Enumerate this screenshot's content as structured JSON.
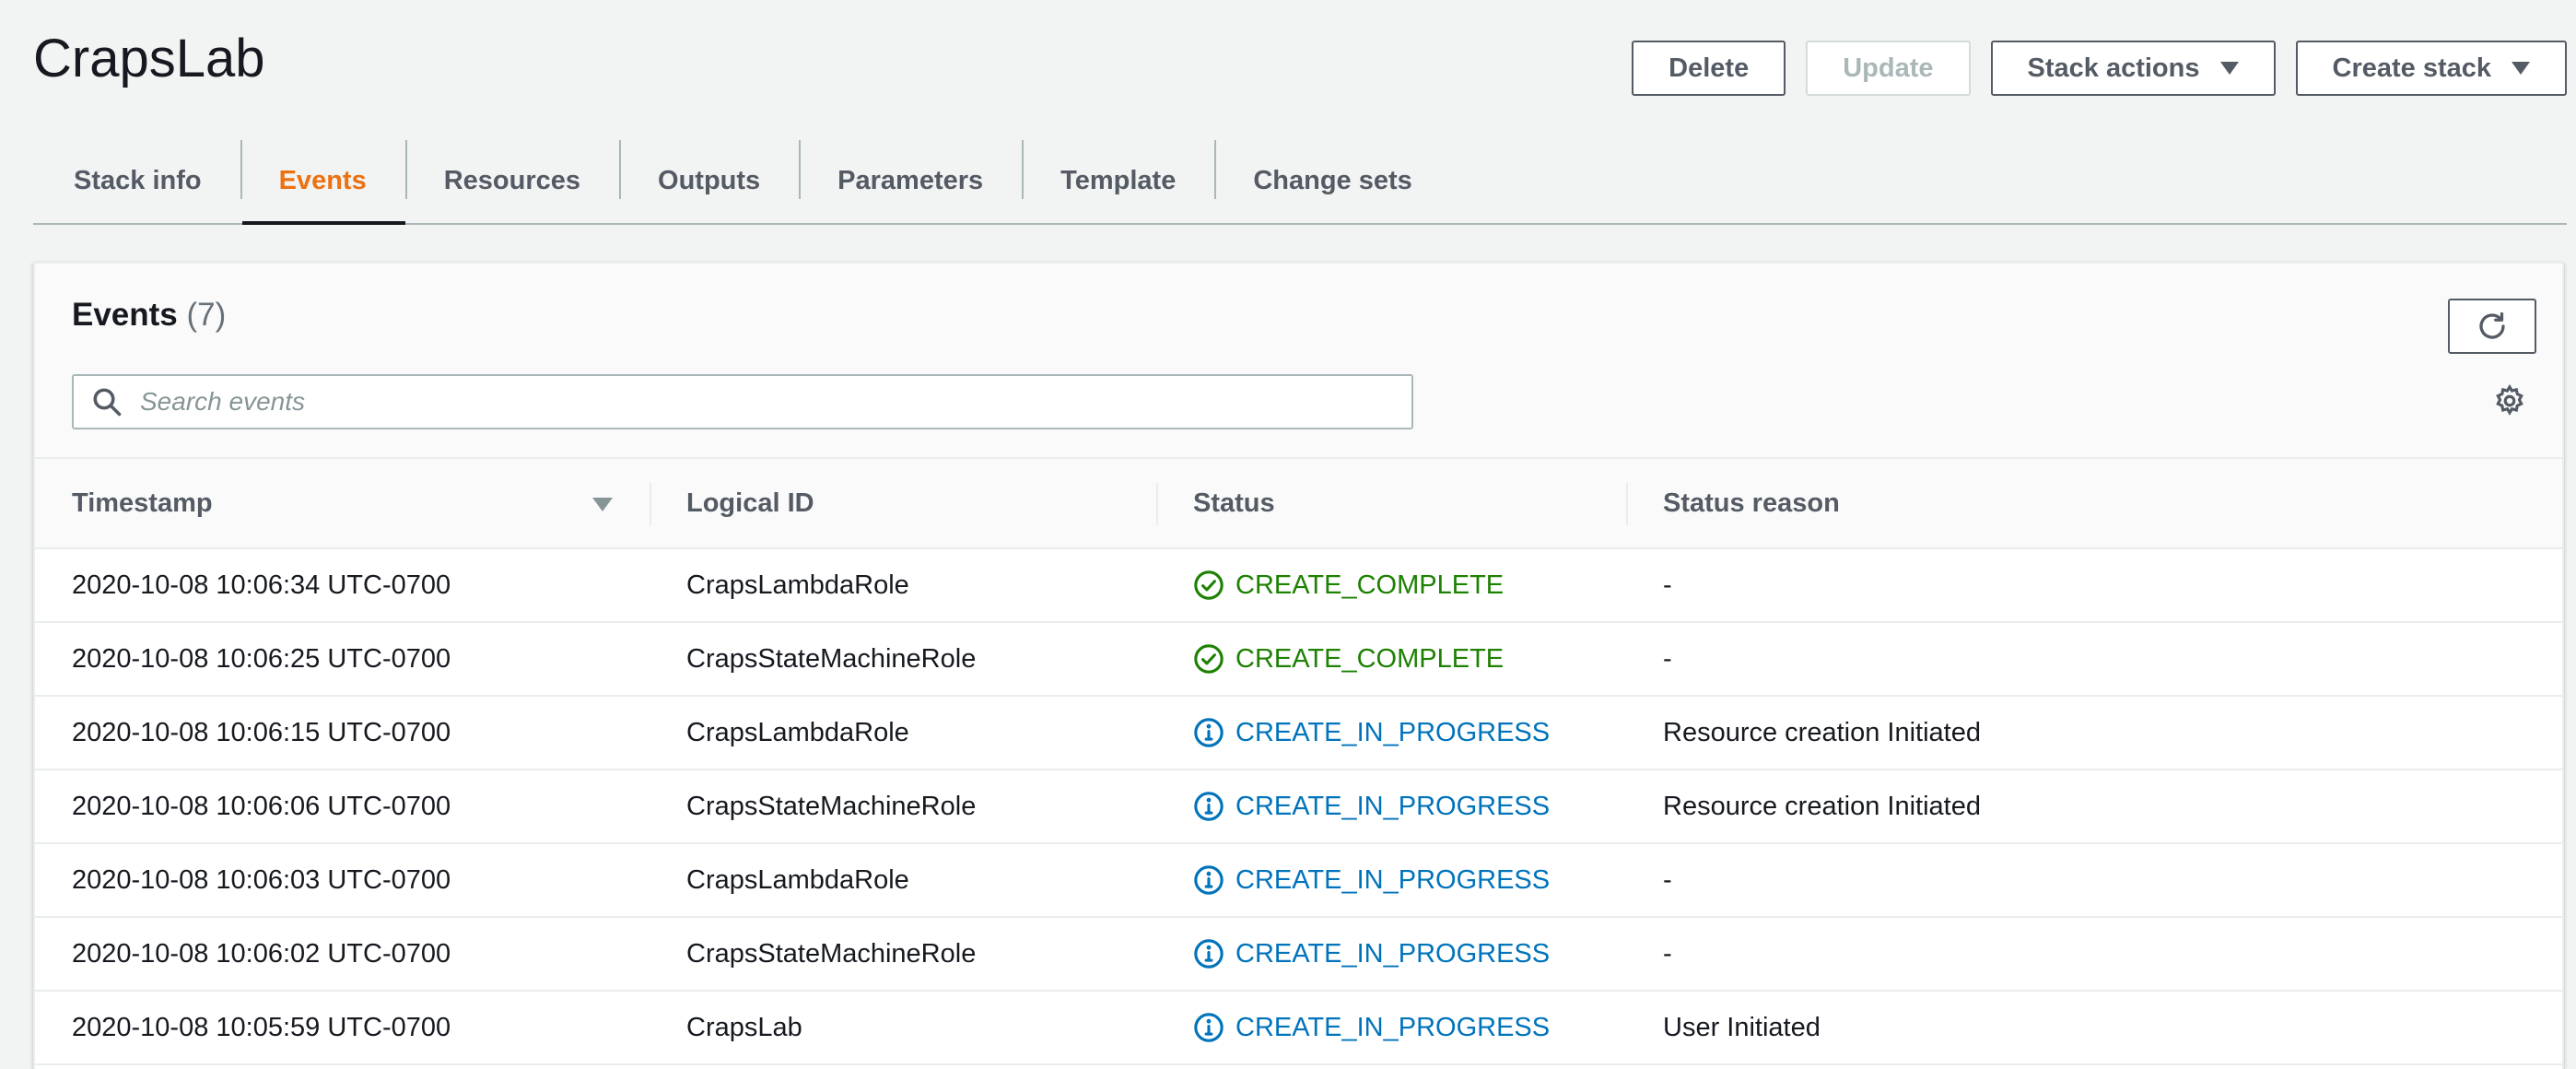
{
  "page": {
    "title": "CrapsLab",
    "buttons": {
      "delete": "Delete",
      "update": "Update",
      "stack_actions": "Stack actions",
      "create_stack": "Create stack"
    }
  },
  "tabs": [
    {
      "label": "Stack info",
      "active": false
    },
    {
      "label": "Events",
      "active": true
    },
    {
      "label": "Resources",
      "active": false
    },
    {
      "label": "Outputs",
      "active": false
    },
    {
      "label": "Parameters",
      "active": false
    },
    {
      "label": "Template",
      "active": false
    },
    {
      "label": "Change sets",
      "active": false
    }
  ],
  "events": {
    "title": "Events",
    "count": "(7)",
    "search_placeholder": "Search events",
    "columns": [
      "Timestamp",
      "Logical ID",
      "Status",
      "Status reason"
    ],
    "rows": [
      {
        "timestamp": "2020-10-08 10:06:34 UTC-0700",
        "logical_id": "CrapsLambdaRole",
        "status": "CREATE_COMPLETE",
        "status_type": "complete",
        "reason": "-"
      },
      {
        "timestamp": "2020-10-08 10:06:25 UTC-0700",
        "logical_id": "CrapsStateMachineRole",
        "status": "CREATE_COMPLETE",
        "status_type": "complete",
        "reason": "-"
      },
      {
        "timestamp": "2020-10-08 10:06:15 UTC-0700",
        "logical_id": "CrapsLambdaRole",
        "status": "CREATE_IN_PROGRESS",
        "status_type": "inprogress",
        "reason": "Resource creation Initiated"
      },
      {
        "timestamp": "2020-10-08 10:06:06 UTC-0700",
        "logical_id": "CrapsStateMachineRole",
        "status": "CREATE_IN_PROGRESS",
        "status_type": "inprogress",
        "reason": "Resource creation Initiated"
      },
      {
        "timestamp": "2020-10-08 10:06:03 UTC-0700",
        "logical_id": "CrapsLambdaRole",
        "status": "CREATE_IN_PROGRESS",
        "status_type": "inprogress",
        "reason": "-"
      },
      {
        "timestamp": "2020-10-08 10:06:02 UTC-0700",
        "logical_id": "CrapsStateMachineRole",
        "status": "CREATE_IN_PROGRESS",
        "status_type": "inprogress",
        "reason": "-"
      },
      {
        "timestamp": "2020-10-08 10:05:59 UTC-0700",
        "logical_id": "CrapsLab",
        "status": "CREATE_IN_PROGRESS",
        "status_type": "inprogress",
        "reason": "User Initiated"
      }
    ]
  },
  "icons": {
    "complete": "check-circle-icon",
    "inprogress": "info-circle-icon",
    "refresh": "refresh-icon",
    "settings": "gear-icon",
    "search": "search-icon"
  },
  "colors": {
    "accent_tab": "#ec7211",
    "complete": "#1d8102",
    "inprogress": "#0073bb"
  }
}
